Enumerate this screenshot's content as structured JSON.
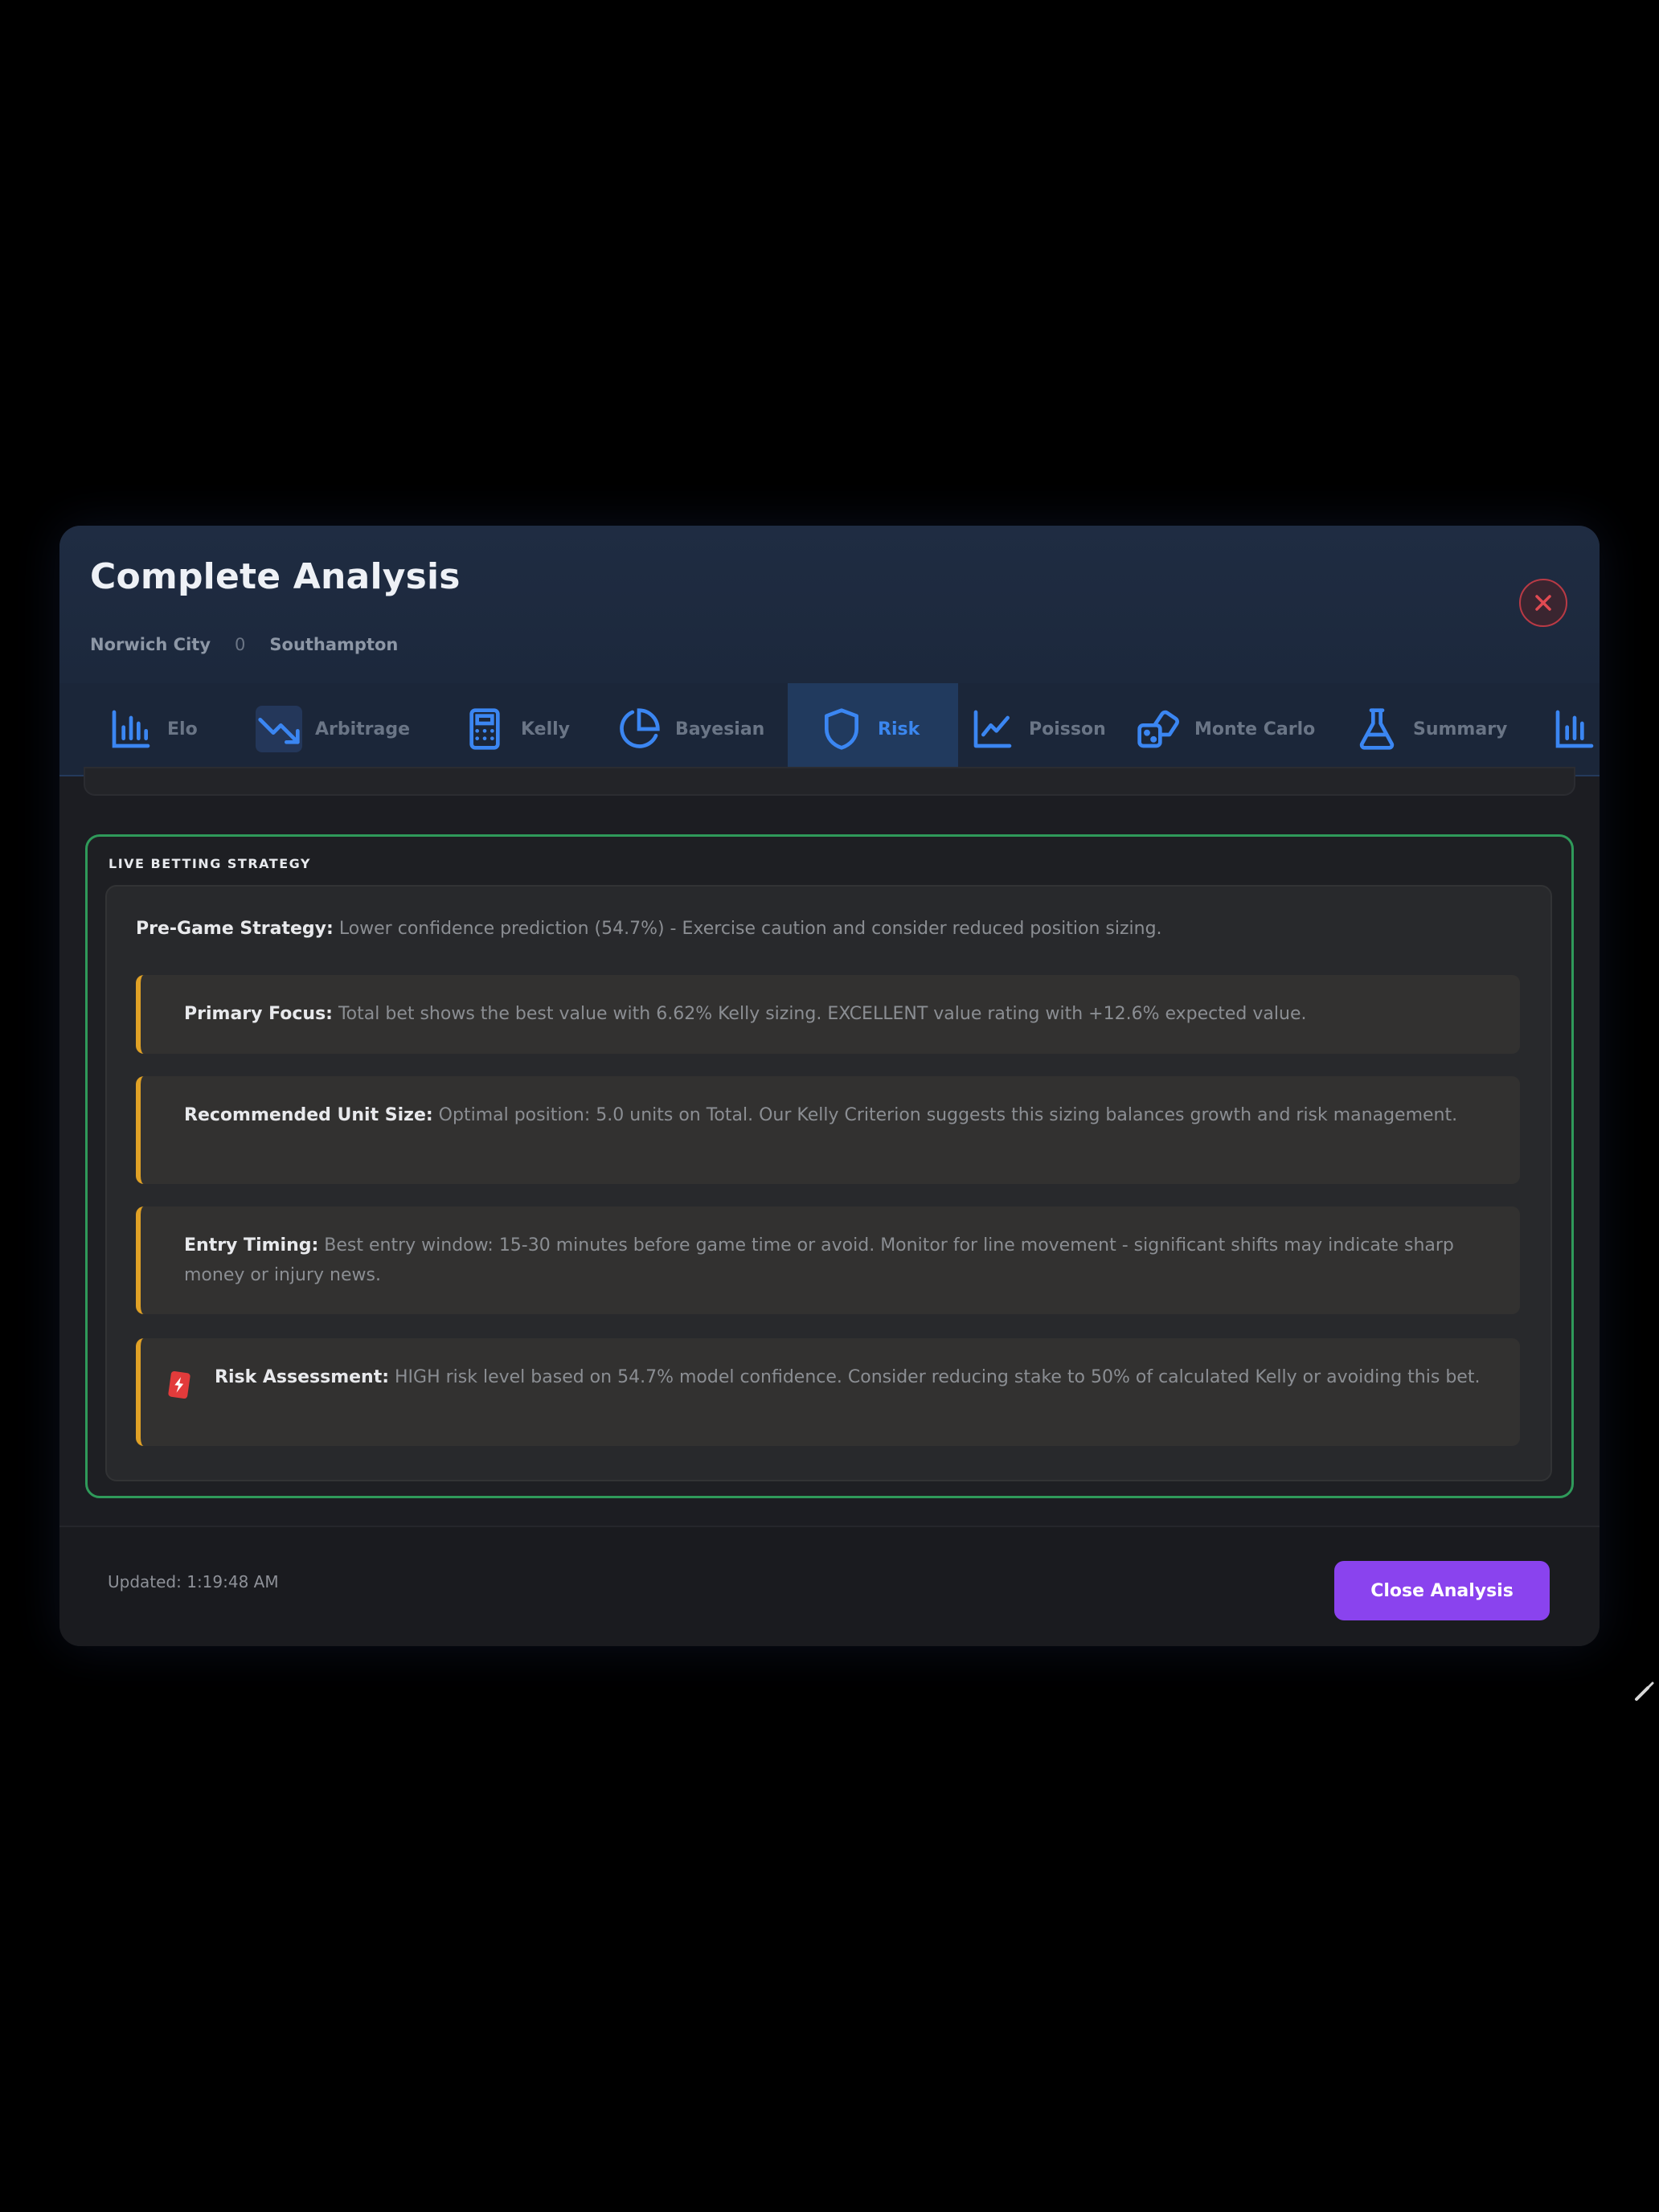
{
  "modal": {
    "title": "Complete Analysis",
    "home_team": "Norwich City",
    "separator": "0",
    "away_team": "Southampton",
    "close_icon": "close-x-icon"
  },
  "tabs": [
    {
      "label": "Elo",
      "icon": "bar-chart-icon"
    },
    {
      "label": "Arbitrage",
      "icon": "trending-down-icon"
    },
    {
      "label": "Kelly",
      "icon": "calculator-icon"
    },
    {
      "label": "Bayesian",
      "icon": "pie-chart-icon"
    },
    {
      "label": "Risk",
      "icon": "shield-icon",
      "active": true
    },
    {
      "label": "Poisson",
      "icon": "line-chart-icon"
    },
    {
      "label": "Monte Carlo",
      "icon": "dice-icon"
    },
    {
      "label": "Summary",
      "icon": "flask-icon"
    },
    {
      "label": "",
      "icon": "bar-chart-icon"
    }
  ],
  "strategy": {
    "section_label": "LIVE BETTING STRATEGY",
    "pregame_label": "Pre-Game Strategy:",
    "pregame_text": " Lower confidence prediction (54.7%) - Exercise caution and consider reduced position sizing.",
    "items": [
      {
        "label": "Primary Focus:",
        "text": " Total bet shows the best value with 6.62% Kelly sizing. EXCELLENT value rating with +12.6% expected value."
      },
      {
        "label": "Recommended Unit Size:",
        "text": " Optimal position: 5.0 units on Total. Our Kelly Criterion suggests this sizing balances growth and risk management."
      },
      {
        "label": "Entry Timing:",
        "text": " Best entry window: 15-30 minutes before game time or avoid. Monitor for line movement - significant shifts may indicate sharp money or injury news."
      },
      {
        "label": "Risk Assessment:",
        "text": " HIGH risk level based on 54.7% model confidence. Consider reducing stake to 50% of calculated Kelly or avoiding this bet.",
        "icon": "warning-icon"
      }
    ]
  },
  "footer": {
    "updated": "Updated: 1:19:48 AM",
    "close_button": "Close Analysis"
  },
  "colors": {
    "accent_blue": "#3b86f2",
    "strategy_border": "#2f9a5a",
    "item_accent": "#e0a126",
    "button": "#8a43ee",
    "close_red": "#b93a45"
  }
}
